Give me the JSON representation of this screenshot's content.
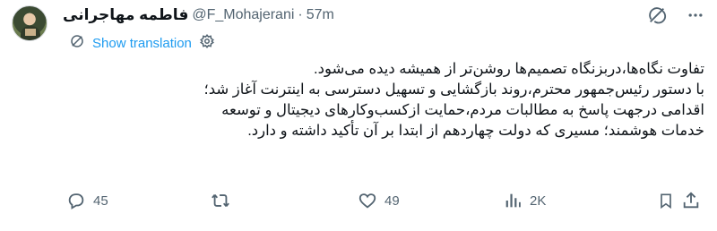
{
  "author": {
    "name": "فاطمه مهاجرانی",
    "handle": "@F_Mohajerani",
    "separator": "·",
    "time": "57m"
  },
  "translate": {
    "label": "Show translation"
  },
  "tweet": {
    "line1": "تفاوت نگاه‌ها،دربزنگاه تصمیم‌ها روشن‌تر از همیشه دیده می‌شود.",
    "paragraph2": "با دستور رئیس‌جمهور محترم،روند بازگشایی و تسهیل دسترسی به اینترنت آغاز شد؛ اقدامی درجهت پاسخ به مطالبات مردم،حمایت ازکسب‌وکارهای دیجیتال و توسعه خدمات هوشمند؛ مسیری که دولت چهاردهم از ابتدا بر آن تأکید داشته و دارد."
  },
  "stats": {
    "replies": "45",
    "reposts": "",
    "likes": "49",
    "views": "2K"
  },
  "icons": {
    "grok": "grok-icon",
    "more": "more-icon",
    "translate": "translate-icon",
    "settings": "gear-icon",
    "reply": "reply-icon",
    "repost": "repost-icon",
    "like": "heart-icon",
    "views": "views-icon",
    "bookmark": "bookmark-icon",
    "share": "share-icon"
  },
  "colors": {
    "text": "#0f1419",
    "secondary": "#536471",
    "link": "#1d9bf0"
  }
}
